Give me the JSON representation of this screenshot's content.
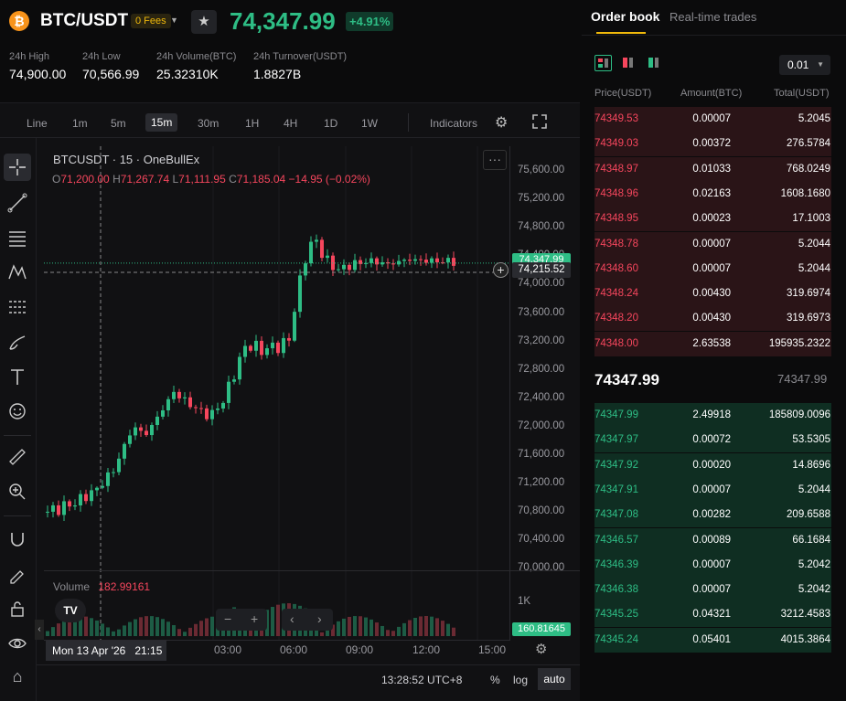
{
  "header": {
    "coin_icon": "bitcoin-icon",
    "pair": "BTC/USDT",
    "fees": "0 Fees",
    "price": "74,347.99",
    "change": "+4.91%",
    "stats": [
      {
        "label": "24h High",
        "value": "74,900.00"
      },
      {
        "label": "24h Low",
        "value": "70,566.99"
      },
      {
        "label": "24h Volume(BTC)",
        "value": "25.32310K"
      },
      {
        "label": "24h Turnover(USDT)",
        "value": "1.8827B"
      }
    ]
  },
  "toolbar": {
    "intervals": [
      "Line",
      "1m",
      "5m",
      "15m",
      "30m",
      "1H",
      "4H",
      "1D",
      "1W"
    ],
    "selected": "15m",
    "indicators": "Indicators"
  },
  "chart": {
    "symbol_line": "BTCUSDT · 15 · OneBullEx",
    "ohlc": {
      "o_label": "O",
      "o": "71,200.00",
      "h_label": "H",
      "h": "71,267.74",
      "l_label": "L",
      "l": "71,111.95",
      "c_label": "C",
      "c": "71,185.04",
      "change": "−14.95 (−0.02%)"
    },
    "volume_label": "Volume",
    "volume_value": "182.99161",
    "price_axis": [
      "75,600.00",
      "75,200.00",
      "74,800.00",
      "74,400.00",
      "74,000.00",
      "73,600.00",
      "73,200.00",
      "72,800.00",
      "72,400.00",
      "72,000.00",
      "71,600.00",
      "71,200.00",
      "70,800.00",
      "70,400.00",
      "70,000.00"
    ],
    "current_price_tag": "74,347.99",
    "crosshair_price_tag": "74,215.52",
    "volume_axis": "1K",
    "volume_tag": "160.81645",
    "time_axis": [
      "03:00",
      "06:00",
      "09:00",
      "12:00",
      "15:00"
    ],
    "crosshair_time": "Mon 13 Apr '26   21:15",
    "clock": "13:28:52 UTC+8",
    "pct": "%",
    "log": "log",
    "auto": "auto",
    "logo": "TV"
  },
  "orderbook": {
    "tabs": [
      "Order book",
      "Real-time trades"
    ],
    "precision": "0.01",
    "columns": [
      "Price(USDT)",
      "Amount(BTC)",
      "Total(USDT)"
    ],
    "asks": [
      [
        "74349.53",
        "0.00007",
        "5.2045"
      ],
      [
        "74349.03",
        "0.00372",
        "276.5784"
      ],
      [
        "74348.97",
        "0.01033",
        "768.0249"
      ],
      [
        "74348.96",
        "0.02163",
        "1608.1680"
      ],
      [
        "74348.95",
        "0.00023",
        "17.1003"
      ],
      [
        "74348.78",
        "0.00007",
        "5.2044"
      ],
      [
        "74348.60",
        "0.00007",
        "5.2044"
      ],
      [
        "74348.24",
        "0.00430",
        "319.6974"
      ],
      [
        "74348.20",
        "0.00430",
        "319.6973"
      ],
      [
        "74348.00",
        "2.63538",
        "195935.2322"
      ]
    ],
    "mid_price": "74347.99",
    "mid_price_ref": "74347.99",
    "bids": [
      [
        "74347.99",
        "2.49918",
        "185809.0096"
      ],
      [
        "74347.97",
        "0.00072",
        "53.5305"
      ],
      [
        "74347.92",
        "0.00020",
        "14.8696"
      ],
      [
        "74347.91",
        "0.00007",
        "5.2044"
      ],
      [
        "74347.08",
        "0.00282",
        "209.6588"
      ],
      [
        "74346.57",
        "0.00089",
        "66.1684"
      ],
      [
        "74346.39",
        "0.00007",
        "5.2042"
      ],
      [
        "74346.38",
        "0.00007",
        "5.2042"
      ],
      [
        "74345.25",
        "0.04321",
        "3212.4583"
      ],
      [
        "74345.24",
        "0.05401",
        "4015.3864"
      ]
    ]
  }
}
